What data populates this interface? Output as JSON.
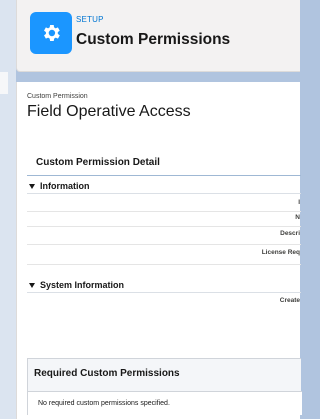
{
  "header": {
    "eyebrow": "SETUP",
    "title": "Custom Permissions",
    "icon": "gear-icon",
    "icon_color": "#1b96ff"
  },
  "record": {
    "eyebrow": "Custom Permission",
    "title": "Field Operative Access"
  },
  "detail": {
    "title": "Custom Permission Detail",
    "sections": [
      {
        "title": "Information",
        "fields": [
          "I",
          "N",
          "Descri",
          "License Req"
        ]
      },
      {
        "title": "System Information",
        "fields": [
          "Create"
        ]
      }
    ]
  },
  "required": {
    "title": "Required Custom Permissions",
    "empty_message": "No required custom permissions specified."
  }
}
